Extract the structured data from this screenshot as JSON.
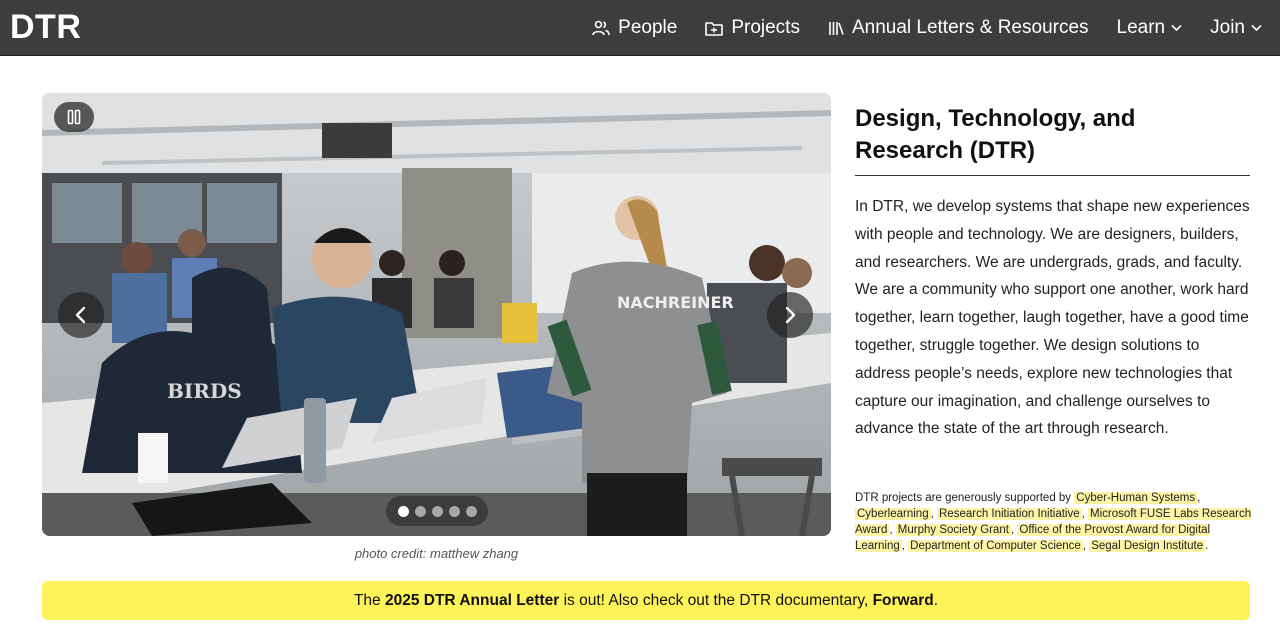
{
  "header": {
    "logo": "DTR",
    "nav": [
      {
        "label": "People",
        "icon": "people-icon"
      },
      {
        "label": "Projects",
        "icon": "folder-icon"
      },
      {
        "label": "Annual Letters & Resources",
        "icon": "library-icon"
      },
      {
        "label": "Learn",
        "icon": "chevron-down-icon"
      },
      {
        "label": "Join",
        "icon": "chevron-down-icon"
      }
    ]
  },
  "carousel": {
    "image_alt": "Students working on laptops in a classroom studio",
    "slide_count": 5,
    "active_slide": 1,
    "jersey_text": "NACHREINER",
    "credit": "photo credit: matthew zhang"
  },
  "about": {
    "title": "Design, Technology, and Research (DTR)",
    "intro": "In DTR, we develop systems that shape new experiences with people and technology. We are designers, builders, and researchers. We are undergrads, grads, and faculty. We are a community who support one another, work hard together, learn together, laugh together, have a good time together, struggle together. We design solutions to address people’s needs, explore new technologies that capture our imagination, and challenge ourselves to advance the state of the art through research.",
    "support_prefix": "DTR projects are generously supported by",
    "sponsors": [
      "Cyber-Human Systems",
      "Cyberlearning",
      "Research Initiation Initiative",
      "Microsoft FUSE Labs Research Award",
      "Murphy Society Grant",
      "Office of the Provost Award for Digital Learning",
      "Department of Computer Science",
      "Segal Design Institute"
    ]
  },
  "banner": {
    "pre": "The",
    "letter_link": "2025 DTR Annual Letter",
    "mid": "is out! Also check out the DTR documentary,",
    "doc_link": "Forward",
    "end": "."
  },
  "colors": {
    "nav_bg": "#3d3d3d",
    "banner_bg": "#fff35a",
    "highlight": "#fdf5a5"
  }
}
